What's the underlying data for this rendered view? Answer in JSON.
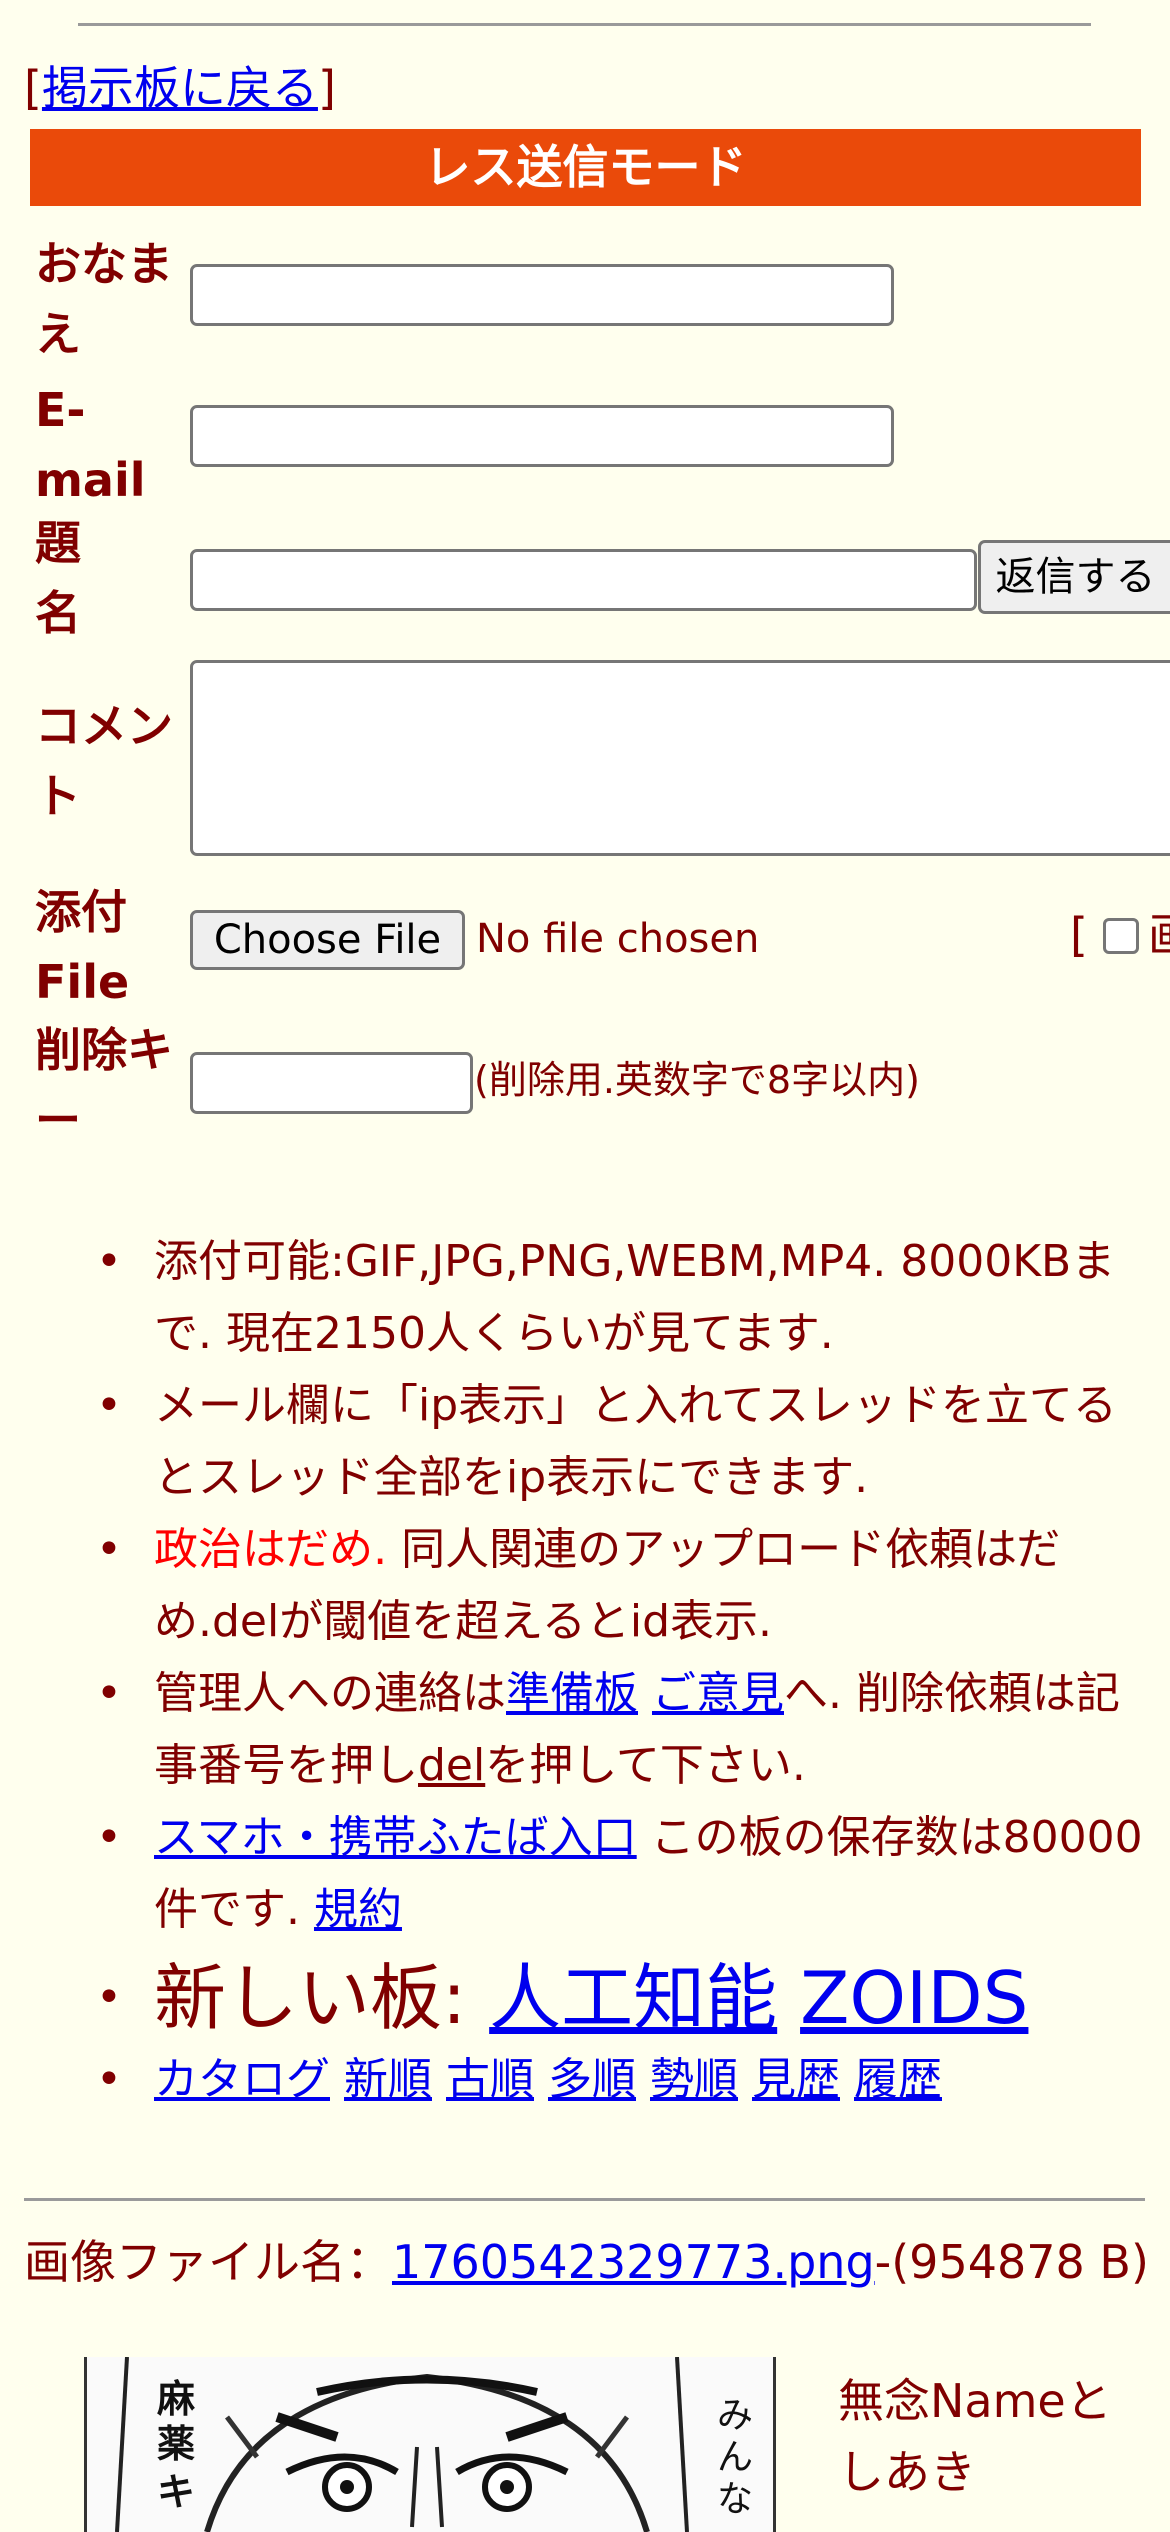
{
  "nav": {
    "bracket_open": "[",
    "back_link": "掲示板に戻る",
    "bracket_close": "]"
  },
  "form": {
    "mode_title": "レス送信モード",
    "name_label_1": "おなま",
    "name_label_2": "え",
    "email_label_1": "E-",
    "email_label_2": "mail",
    "subject_label_1": "題",
    "subject_label_2": "名",
    "submit_label": "返信する",
    "comment_label_1": "コメン",
    "comment_label_2": "ト",
    "file_label_1": "添付",
    "file_label_2": "File",
    "choose_file_label": "Choose File",
    "no_file_text": "No file chosen",
    "image_toggle_open": "[",
    "image_toggle_char": "画",
    "delkey_label_1": "削除キ",
    "delkey_label_2": "ー",
    "delkey_hint": "(削除用.英数字で8字以内)"
  },
  "info": {
    "line1": "添付可能:GIF,JPG,PNG,WEBM,MP4. 8000KBまで. 現在2150人くらいが見てます.",
    "line2": "メール欄に「ip表示」と入れてスレッドを立てるとスレッド全部をip表示にできます.",
    "line3_red": "政治はだめ.",
    "line3_rest": " 同人関連のアップロード依頼はだめ.delが閾値を超えるとid表示.",
    "line4_pre": "管理人への連絡は",
    "line4_link1": "準備板",
    "line4_link2": "ご意見",
    "line4_mid": "へ. 削除依頼は記事番号を押し",
    "line4_del": "del",
    "line4_post": "を押して下さい.",
    "line5_link": "スマホ・携帯ふたば入口",
    "line5_mid": " この板の保存数は80000件です. ",
    "line5_rules": "規約",
    "line6_pre": "新しい板: ",
    "line6_link1": "人工知能",
    "line6_link2": "ZOIDS",
    "sort_links": [
      "カタログ",
      "新順",
      "古順",
      "多順",
      "勢順",
      "見歴",
      "履歴"
    ]
  },
  "post": {
    "file_prefix": "画像ファイル名：",
    "file_link": "1760542329773.png",
    "file_size": "-(954878 B)",
    "subject_line": "無念Nameとしあき"
  }
}
